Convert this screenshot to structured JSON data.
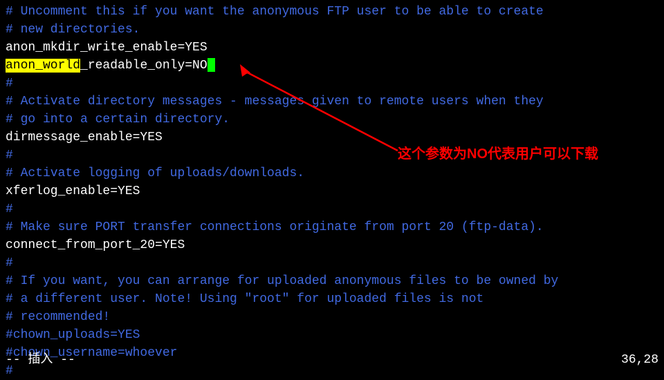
{
  "lines": {
    "l1": "# Uncomment this if you want the anonymous FTP user to be able to create",
    "l2": "# new directories.",
    "l3": "anon_mkdir_write_enable=YES",
    "l4_highlight": "anon_world",
    "l4_rest": "_readable_only=NO",
    "l5": "#",
    "l6": "# Activate directory messages - messages given to remote users when they",
    "l7": "# go into a certain directory.",
    "l8": "dirmessage_enable=YES",
    "l9": "#",
    "l10": "# Activate logging of uploads/downloads.",
    "l11": "xferlog_enable=YES",
    "l12": "#",
    "l13": "# Make sure PORT transfer connections originate from port 20 (ftp-data).",
    "l14": "connect_from_port_20=YES",
    "l15": "#",
    "l16": "# If you want, you can arrange for uploaded anonymous files to be owned by",
    "l17": "# a different user. Note! Using \"root\" for uploaded files is not",
    "l18": "# recommended!",
    "l19": "#chown_uploads=YES",
    "l20": "#chown_username=whoever",
    "l21": "#"
  },
  "annotation": "这个参数为NO代表用户可以下载",
  "status": {
    "mode": "-- 插入 --",
    "position": "36,28"
  }
}
